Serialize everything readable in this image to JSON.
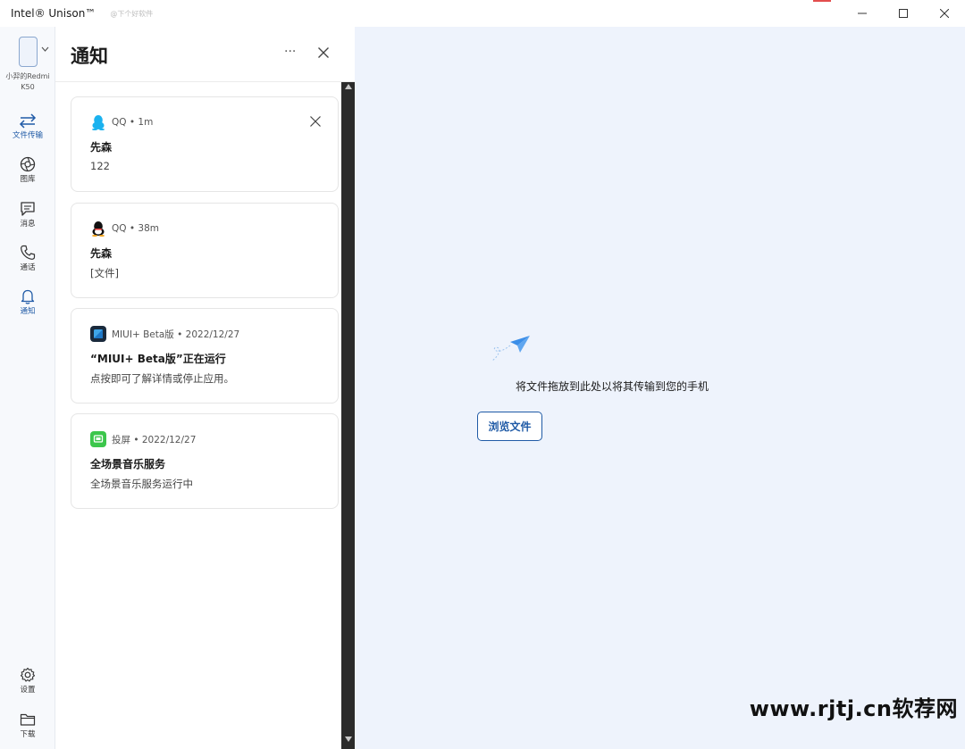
{
  "window": {
    "title": "Intel® Unison™",
    "top_watermark": "@下个好软件"
  },
  "rail": {
    "device_name": "小羿的Redmi K50",
    "items": [
      {
        "label": "文件传输",
        "icon": "transfer-icon",
        "active": true
      },
      {
        "label": "图库",
        "icon": "gallery-icon",
        "active": false
      },
      {
        "label": "消息",
        "icon": "message-icon",
        "active": false
      },
      {
        "label": "通话",
        "icon": "phone-icon",
        "active": false
      },
      {
        "label": "通知",
        "icon": "bell-icon",
        "active": true
      },
      {
        "label": "设置",
        "icon": "gear-icon",
        "active": false
      },
      {
        "label": "下载",
        "icon": "folder-icon",
        "active": false
      }
    ]
  },
  "panel": {
    "title": "通知",
    "more": "···"
  },
  "notifications": [
    {
      "app": "QQ",
      "meta": "QQ • 1m",
      "title": "先森",
      "body": "122",
      "icon": "qq-color-icon"
    },
    {
      "app": "QQ",
      "meta": "QQ • 38m",
      "title": "先森",
      "body": "[文件]",
      "icon": "qq-bw-icon"
    },
    {
      "app": "MIUI+ Beta版",
      "meta": "MIUI+ Beta版 • 2022/12/27",
      "title": "“MIUI+ Beta版”正在运行",
      "body": "点按即可了解详情或停止应用。",
      "icon": "miui-icon"
    },
    {
      "app": "投屏",
      "meta": "投屏 • 2022/12/27",
      "title": "全场景音乐服务",
      "body": "全场景音乐服务运行中",
      "icon": "cast-icon"
    }
  ],
  "main": {
    "drop_text": "将文件拖放到此处以将其传输到您的手机",
    "browse_label": "浏览文件"
  },
  "watermark": "www.rjtj.cn软荐网",
  "colors": {
    "accent": "#1f5aa6",
    "main_bg": "#eef3fc",
    "plane": "#3b8ee8"
  }
}
